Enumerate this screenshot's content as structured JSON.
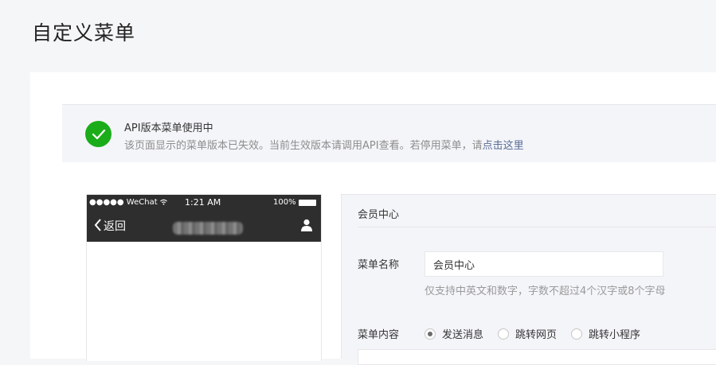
{
  "page": {
    "title": "自定义菜单"
  },
  "notice": {
    "title": "API版本菜单使用中",
    "description": "该页面显示的菜单版本已失效。当前生效版本请调用API查看。若停用菜单，请",
    "link": "点击这里",
    "icon": "check-circle-icon",
    "icon_color": "#1aad19"
  },
  "phone": {
    "carrier": "●●●●● WeChat",
    "time": "1:21 AM",
    "battery": "100%",
    "back_label": "返回",
    "account_name": "",
    "user_icon": "user-icon"
  },
  "form": {
    "header": "会员中心",
    "name_label": "菜单名称",
    "name_value": "会员中心",
    "name_hint": "仅支持中英文和数字，字数不超过4个汉字或8个字母",
    "content_label": "菜单内容",
    "options": [
      {
        "label": "发送消息",
        "checked": true
      },
      {
        "label": "跳转网页",
        "checked": false
      },
      {
        "label": "跳转小程序",
        "checked": false
      }
    ]
  }
}
